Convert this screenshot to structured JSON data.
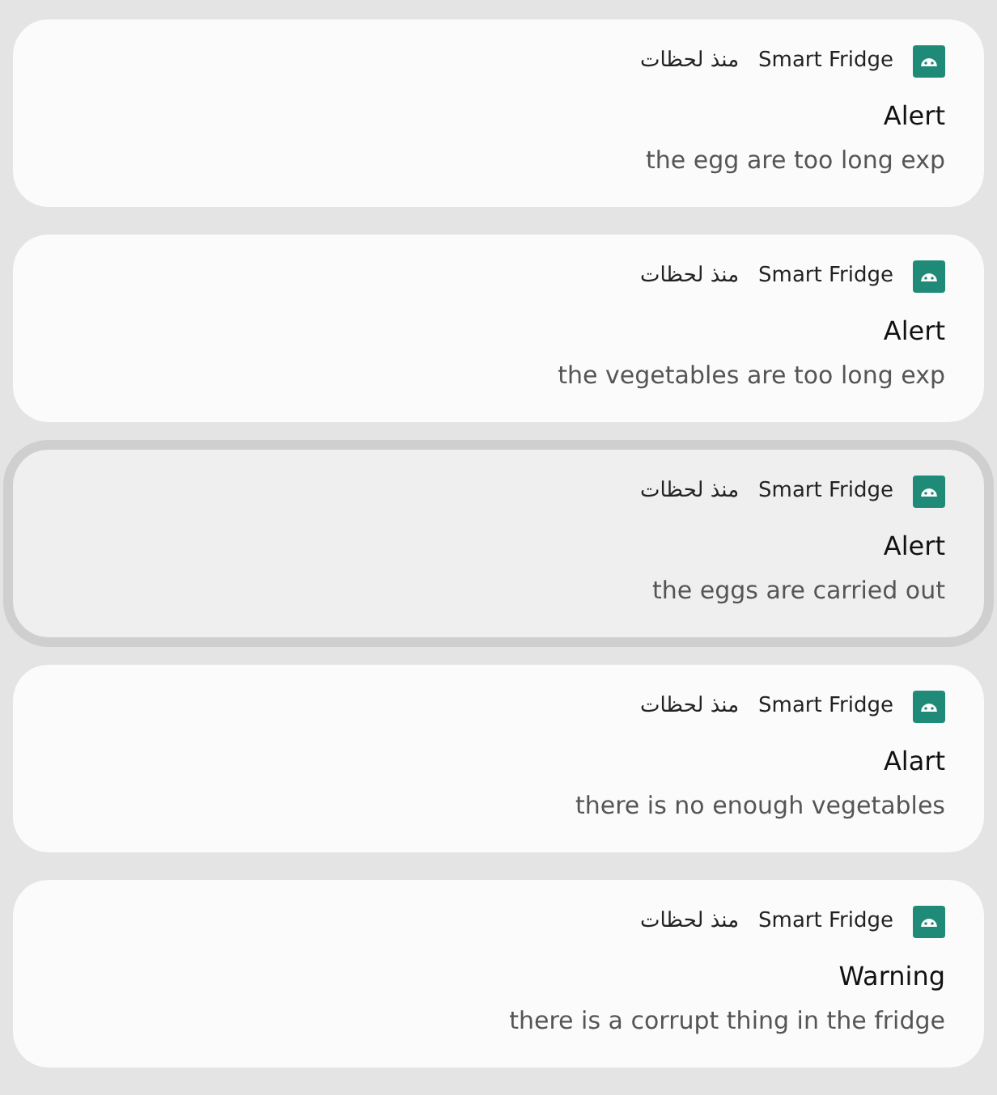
{
  "notifications": [
    {
      "app": "Smart Fridge",
      "time": "منذ لحظات",
      "title": "Alert",
      "body": "the egg are too long exp",
      "selected": false
    },
    {
      "app": "Smart Fridge",
      "time": "منذ لحظات",
      "title": "Alert",
      "body": "the vegetables are too long exp",
      "selected": false
    },
    {
      "app": "Smart Fridge",
      "time": "منذ لحظات",
      "title": "Alert",
      "body": "the eggs are carried out",
      "selected": true
    },
    {
      "app": "Smart Fridge",
      "time": "منذ لحظات",
      "title": "Alart",
      "body": "there is no enough vegetables",
      "selected": false
    },
    {
      "app": "Smart Fridge",
      "time": "منذ لحظات",
      "title": "Warning",
      "body": "there is a corrupt thing in the fridge",
      "selected": false
    }
  ]
}
